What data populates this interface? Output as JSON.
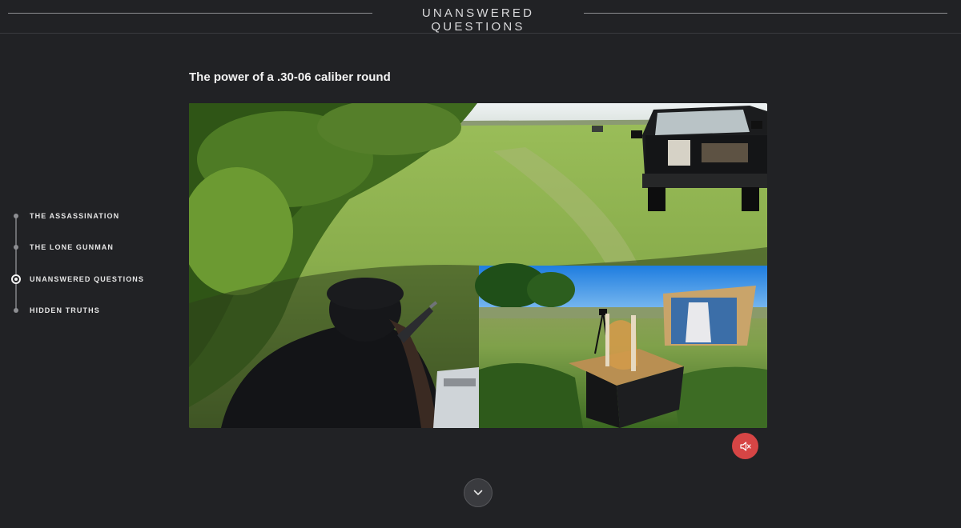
{
  "header": {
    "title": "UNANSWERED QUESTIONS"
  },
  "sidenav": {
    "items": [
      {
        "label": "THE ASSASSINATION",
        "active": false
      },
      {
        "label": "THE LONE GUNMAN",
        "active": false
      },
      {
        "label": "UNANSWERED QUESTIONS",
        "active": true
      },
      {
        "label": "HIDDEN TRUTHS",
        "active": false
      }
    ]
  },
  "main": {
    "heading": "The power of a .30-06 caliber round"
  },
  "controls": {
    "mute_icon": "speaker-muted-icon",
    "scroll_icon": "chevron-down-icon",
    "mute_color": "#d64545"
  }
}
